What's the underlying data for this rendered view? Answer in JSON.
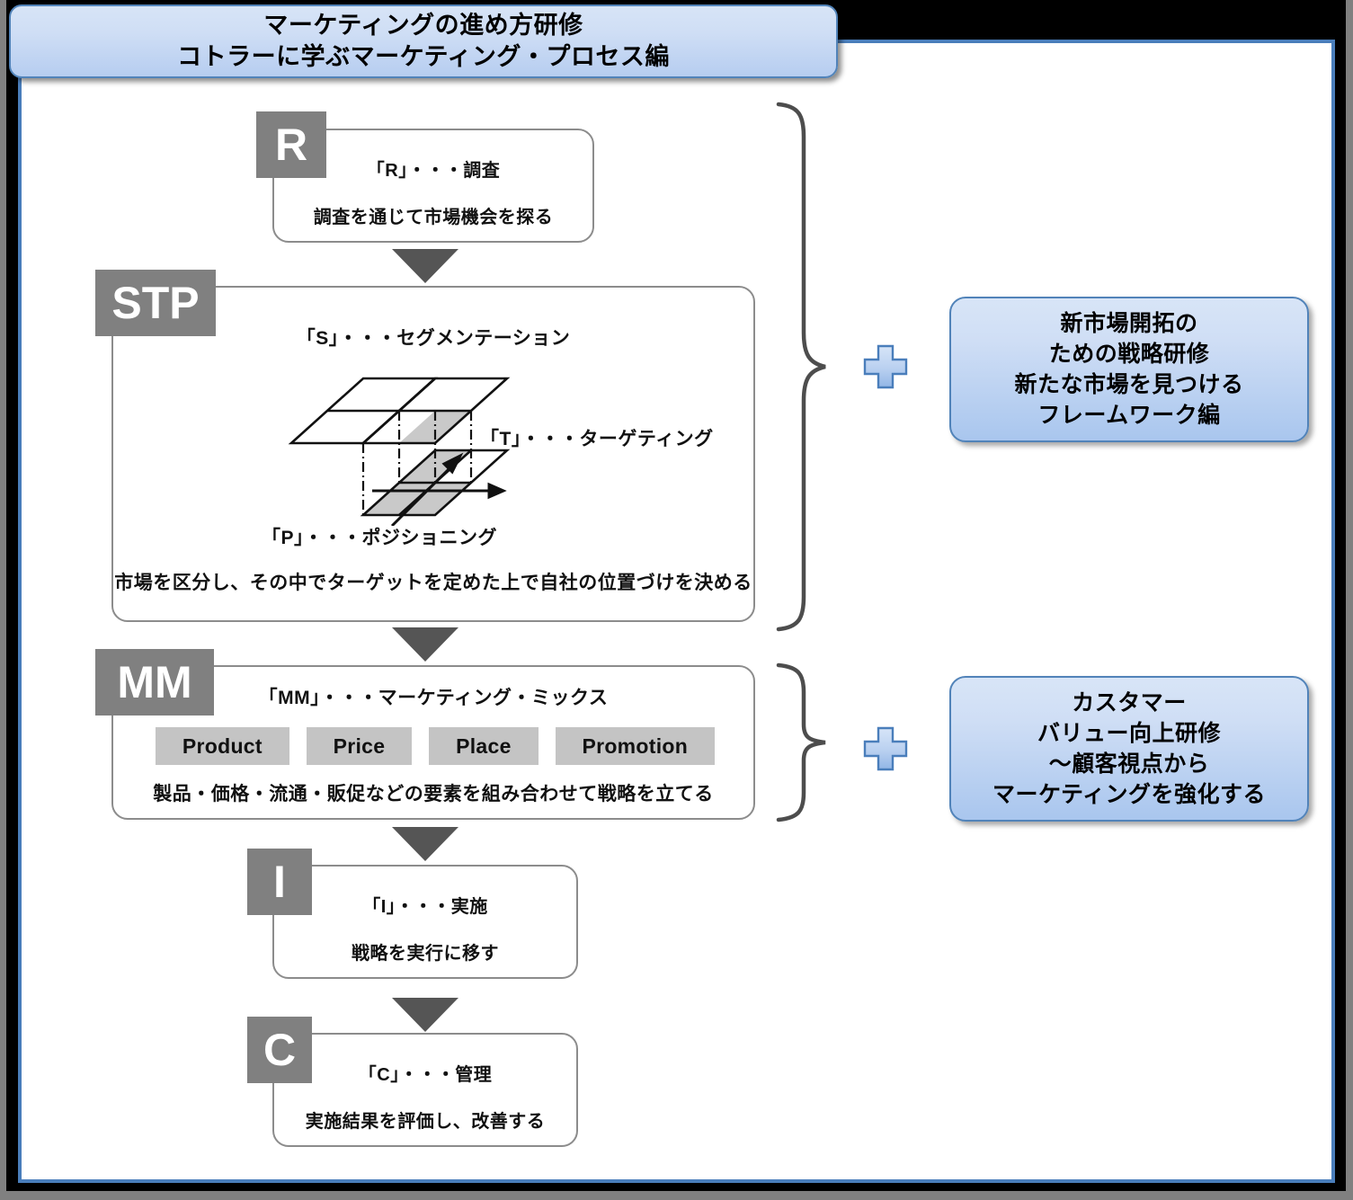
{
  "title": {
    "line1": "マーケティングの進め方研修",
    "line2": "コトラーに学ぶマーケティング・プロセス編"
  },
  "colors": {
    "frame_gray": "#808080",
    "frame_blue": "#4a7ebb",
    "label_gray": "#808080",
    "arrow_gray": "#555555",
    "chip_gray": "#c4c4c4",
    "pill_blue": "#a9c6ee",
    "pill_border": "#5183b9"
  },
  "stages": [
    {
      "id": "r",
      "label": "R",
      "heading": "「R」・・・調査",
      "description": "調査を通じて市場機会を探る"
    },
    {
      "id": "stp",
      "label": "STP",
      "heading_s": "「S」・・・セグメンテーション",
      "heading_t": "「T」・・・ターゲティング",
      "heading_p": "「P」・・・ポジショニング",
      "description": "市場を区分し、その中でターゲットを定めた上で自社の位置づけを決める"
    },
    {
      "id": "mm",
      "label": "MM",
      "heading": "「MM」・・・マーケティング・ミックス",
      "chips": [
        "Product",
        "Price",
        "Place",
        "Promotion"
      ],
      "description": "製品・価格・流通・販促などの要素を組み合わせて戦略を立てる"
    },
    {
      "id": "i",
      "label": "I",
      "heading": "「I」・・・実施",
      "description": "戦略を実行に移す"
    },
    {
      "id": "c",
      "label": "C",
      "heading": "「C」・・・管理",
      "description": "実施結果を評価し、改善する"
    }
  ],
  "callouts": [
    {
      "id": "callout-1",
      "plus_icon": "plus-icon",
      "lines": [
        "新市場開拓の",
        "ための戦略研修",
        "新たな市場を見つける",
        "フレームワーク編"
      ]
    },
    {
      "id": "callout-2",
      "plus_icon": "plus-icon",
      "lines": [
        "カスタマー",
        "バリュー向上研修",
        "〜顧客視点から",
        "マーケティングを強化する"
      ]
    }
  ],
  "figure": {
    "name": "stp-3d-grid-diagram",
    "description": "2枚の格子平面と軸矢印によるセグメンテーション/ターゲティング/ポジショニング概念図"
  }
}
